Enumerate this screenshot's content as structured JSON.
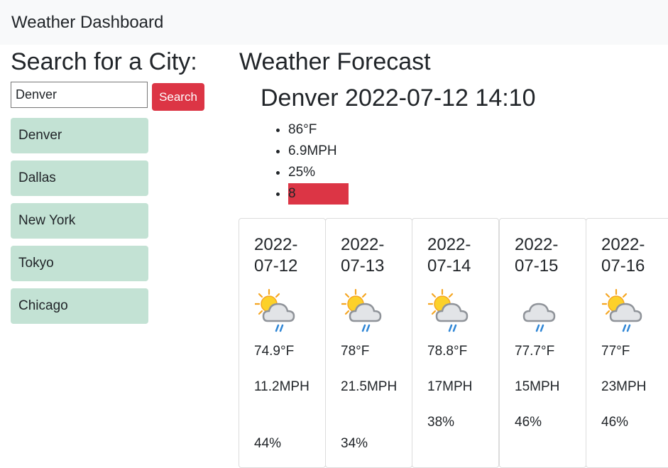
{
  "navbar": {
    "title": "Weather Dashboard"
  },
  "search": {
    "heading": "Search for a City:",
    "input_value": "Denver",
    "button_label": "Search"
  },
  "history": [
    "Denver",
    "Dallas",
    "New York",
    "Tokyo",
    "Chicago"
  ],
  "forecast": {
    "heading": "Weather Forecast",
    "current": {
      "title": "Denver 2022-07-12 14:10",
      "temp": "86°F",
      "wind": "6.9MPH",
      "humidity": "25%",
      "uv_index": "8",
      "uv_color": "#dc3545"
    },
    "days": [
      {
        "date": "2022-07-12",
        "icon": "partly-cloudy-rain-icon",
        "temp": "74.9°F",
        "wind": "11.2MPH",
        "humidity": "44%"
      },
      {
        "date": "2022-07-13",
        "icon": "partly-cloudy-rain-icon",
        "temp": "78°F",
        "wind": "21.5MPH",
        "humidity": "34%"
      },
      {
        "date": "2022-07-14",
        "icon": "partly-cloudy-rain-icon",
        "temp": "78.8°F",
        "wind": "17MPH",
        "humidity": "38%"
      },
      {
        "date": "2022-07-15",
        "icon": "cloud-rain-icon",
        "temp": "77.7°F",
        "wind": "15MPH",
        "humidity": "46%"
      },
      {
        "date": "2022-07-16",
        "icon": "partly-cloudy-rain-icon",
        "temp": "77°F",
        "wind": "23MPH",
        "humidity": "46%"
      }
    ]
  },
  "colors": {
    "accent": "#dc3545",
    "history_bg": "#c3e2d4",
    "navbar_bg": "#f8f9fa"
  }
}
